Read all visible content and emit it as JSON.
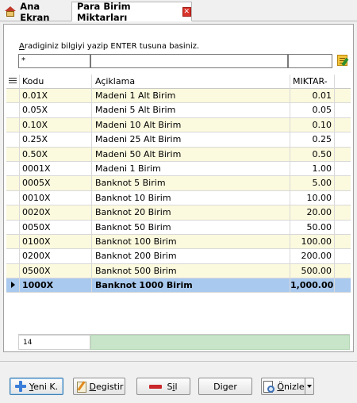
{
  "tabs": [
    {
      "label": "Ana Ekran"
    },
    {
      "label": "Para Birim Miktarları"
    }
  ],
  "search": {
    "hint_prefix": "A",
    "hint_rest": "radiginiz bilgiyi yazip ENTER tusuna basiniz.",
    "kod_value": "*",
    "aciklama_value": "",
    "miktar_value": ""
  },
  "columns": {
    "kod": "Kodu",
    "aciklama": "Açiklama",
    "miktar": "MIKTAR-"
  },
  "rows": [
    {
      "kod": "0.01X",
      "aciklama": "Madeni 1 Alt Birim",
      "miktar": "0.01"
    },
    {
      "kod": "0.05X",
      "aciklama": "Madeni 5 Alt Birim",
      "miktar": "0.05"
    },
    {
      "kod": "0.10X",
      "aciklama": "Madeni 10 Alt Birim",
      "miktar": "0.10"
    },
    {
      "kod": "0.25X",
      "aciklama": "Madeni 25 Alt Birim",
      "miktar": "0.25"
    },
    {
      "kod": "0.50X",
      "aciklama": "Madeni 50 Alt Birim",
      "miktar": "0.50"
    },
    {
      "kod": "0001X",
      "aciklama": "Madeni 1 Birim",
      "miktar": "1.00"
    },
    {
      "kod": "0005X",
      "aciklama": "Banknot 5 Birim",
      "miktar": "5.00"
    },
    {
      "kod": "0010X",
      "aciklama": "Banknot 10 Birim",
      "miktar": "10.00"
    },
    {
      "kod": "0020X",
      "aciklama": "Banknot 20 Birim",
      "miktar": "20.00"
    },
    {
      "kod": "0050X",
      "aciklama": "Banknot 50 Birim",
      "miktar": "50.00"
    },
    {
      "kod": "0100X",
      "aciklama": "Banknot 100 Birim",
      "miktar": "100.00"
    },
    {
      "kod": "0200X",
      "aciklama": "Banknot 200 Birim",
      "miktar": "200.00"
    },
    {
      "kod": "0500X",
      "aciklama": "Banknot 500 Birim",
      "miktar": "500.00"
    },
    {
      "kod": "1000X",
      "aciklama": "Banknot 1000 Birim",
      "miktar": "1,000.00"
    }
  ],
  "selected_row": 13,
  "footer": {
    "count": "14"
  },
  "buttons": {
    "yeni_u": "Y",
    "yeni_rest": "eni K.",
    "degistir_u": "D",
    "degistir_rest": "egistir",
    "sil_pre": "S",
    "sil_u": "i",
    "sil_rest": "l",
    "diger": "Diger",
    "onizle_u": "Ö",
    "onizle_rest": "nizle"
  },
  "colors": {
    "row_alt": "#fbf9de",
    "row_selected": "#a9c9ee",
    "footer_green": "#c9e5c9",
    "close_red": "#d9342b"
  }
}
